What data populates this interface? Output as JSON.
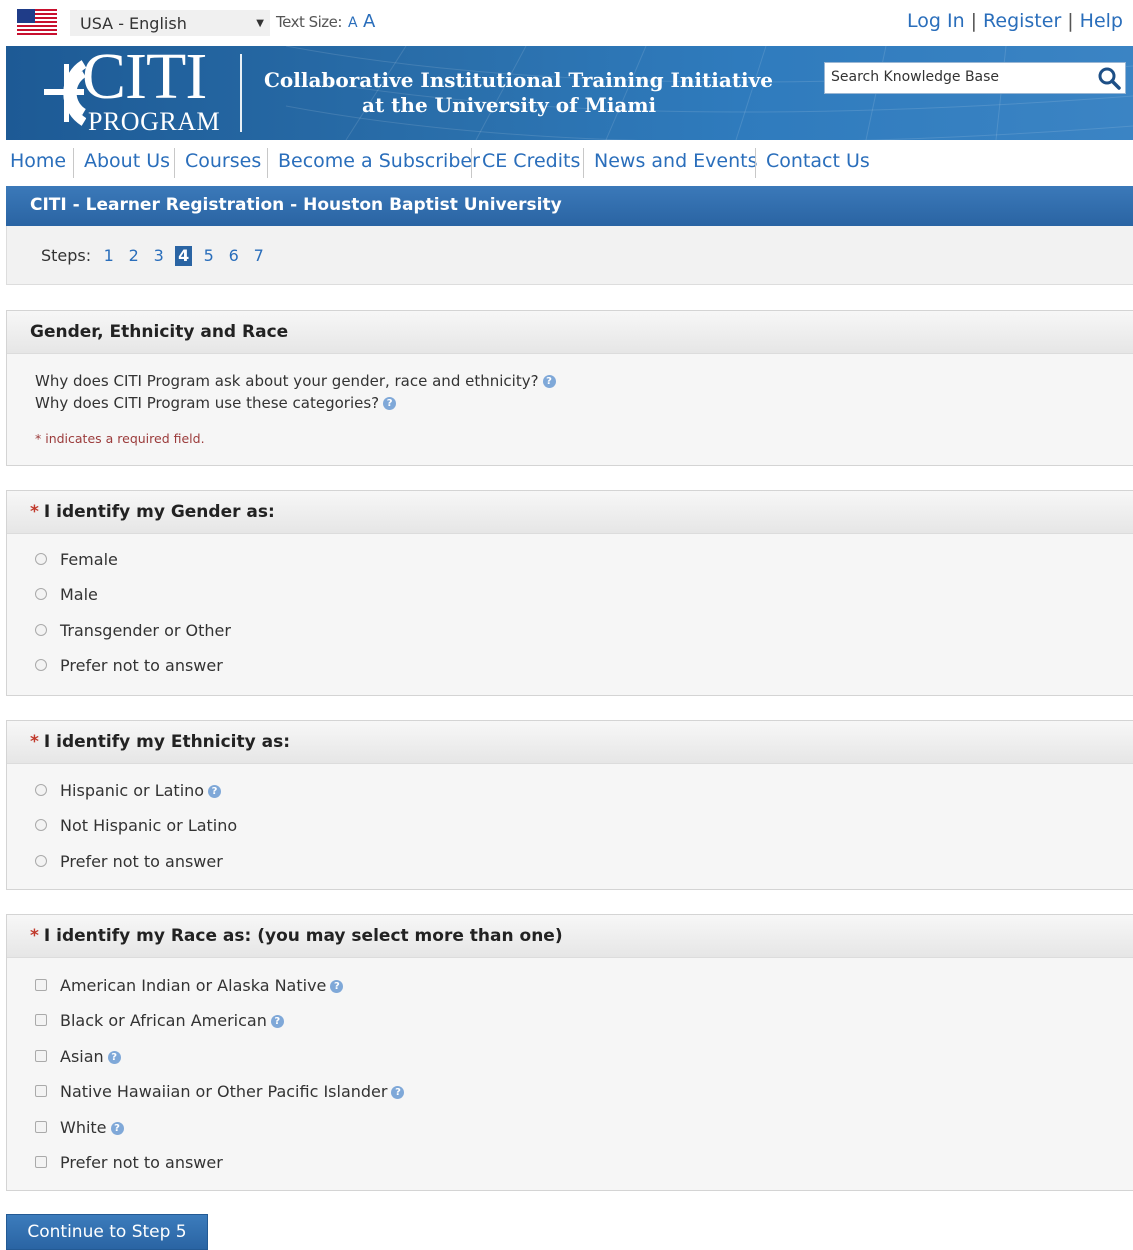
{
  "topbar": {
    "language": "USA - English",
    "text_size_label": "Text Size:",
    "text_size_small": "A",
    "text_size_large": "A",
    "links": [
      "Log In",
      "Register",
      "Help"
    ]
  },
  "banner": {
    "logo_main": "CITI",
    "logo_sub": "PROGRAM",
    "tagline_line1": "Collaborative Institutional Training Initiative",
    "tagline_line2": "at the University of Miami",
    "search_placeholder": "Search Knowledge Base"
  },
  "nav": [
    "Home",
    "About Us",
    "Courses",
    "Become a Subscriber",
    "CE Credits",
    "News and Events",
    "Contact Us"
  ],
  "page_title": "CITI - Learner Registration - Houston Baptist University",
  "steps": {
    "label": "Steps:",
    "items": [
      "1",
      "2",
      "3",
      "4",
      "5",
      "6",
      "7"
    ],
    "current": "4"
  },
  "intro": {
    "title": "Gender, Ethnicity and Race",
    "why_ask": "Why does CITI Program ask about your gender, race and ethnicity?",
    "why_categories": "Why does CITI Program use these categories?",
    "required_note": "* indicates a required field."
  },
  "gender": {
    "title": "I identify my Gender as:",
    "options": [
      "Female",
      "Male",
      "Transgender or Other",
      "Prefer not to answer"
    ]
  },
  "ethnicity": {
    "title": "I identify my Ethnicity as:",
    "options": [
      "Hispanic or Latino",
      "Not Hispanic or Latino",
      "Prefer not to answer"
    ]
  },
  "race": {
    "title": "I identify my Race as: (you may select more than one)",
    "options": [
      "American Indian or Alaska Native",
      "Black or African American",
      "Asian",
      "Native Hawaiian or Other Pacific Islander",
      "White",
      "Prefer not to answer"
    ]
  },
  "required_marker": "*",
  "continue_label": "Continue to  Step 5",
  "colors": {
    "link": "#2a6ebb",
    "header_blue": "#2a64a3",
    "required": "#c0392b"
  }
}
